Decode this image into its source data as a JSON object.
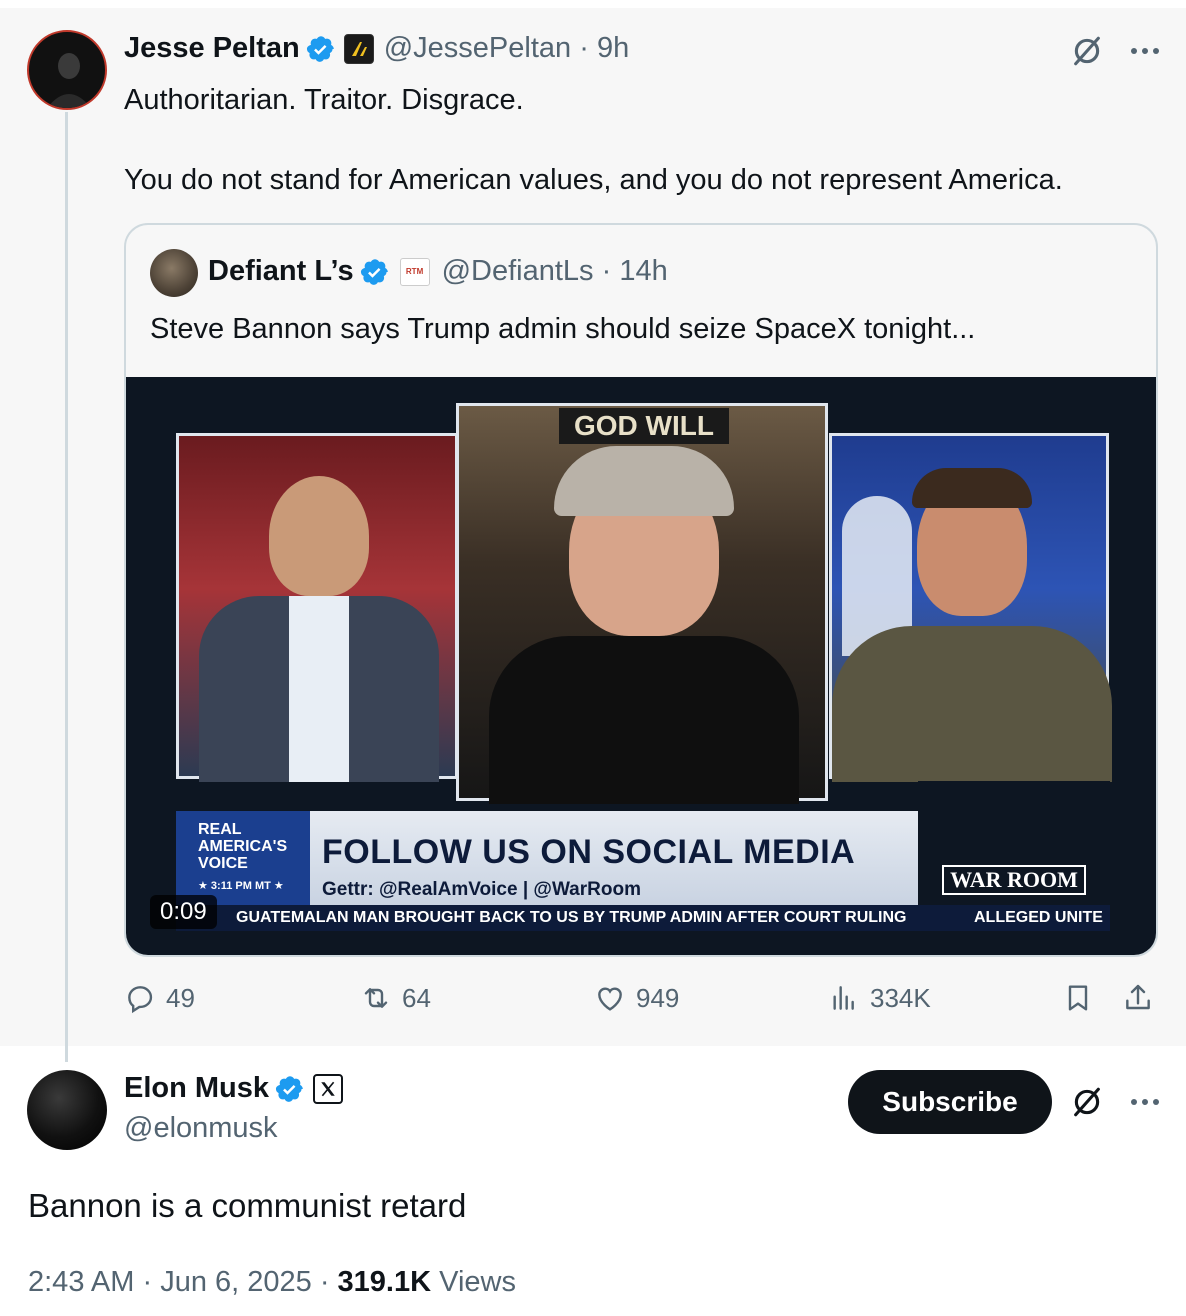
{
  "parent_tweet": {
    "name": "Jesse Peltan",
    "handle": "@JessePeltan",
    "time": "9h",
    "text_line1": "Authoritarian. Traitor. Disgrace.",
    "text_line2": "You do not stand for American values, and you do not represent America.",
    "quote": {
      "name": "Defiant L’s",
      "badge": "RTM",
      "handle": "@DefiantLs",
      "time": "14h",
      "text": "Steve Bannon says Trump admin should seize SpaceX tonight...",
      "video": {
        "duration": "0:09",
        "top_sign": "GOD WILL",
        "channel_logo_lines": [
          "REAL",
          "AMERICA'S",
          "VOICE"
        ],
        "clock": "3:11 PM MT",
        "headline": "FOLLOW US ON SOCIAL MEDIA",
        "subline": "Gettr: @RealAmVoice | @WarRoom",
        "show_logo": "WAR ROOM",
        "ticker": "GUATEMALAN MAN BROUGHT BACK TO US BY TRUMP ADMIN AFTER COURT RULING",
        "ticker_right": "ALLEGED UNITE"
      }
    },
    "actions": {
      "replies": "49",
      "reposts": "64",
      "likes": "949",
      "views": "334K"
    }
  },
  "main_tweet": {
    "name": "Elon Musk",
    "handle": "@elonmusk",
    "subscribe_label": "Subscribe",
    "text": "Bannon is a communist retard",
    "time": "2:43 AM",
    "date": "Jun 6, 2025",
    "views_count": "319.1K",
    "views_label": "Views"
  },
  "colors": {
    "verified_blue": "#1d9bf0",
    "secondary_text": "#536471",
    "primary_text": "#0f1419"
  }
}
